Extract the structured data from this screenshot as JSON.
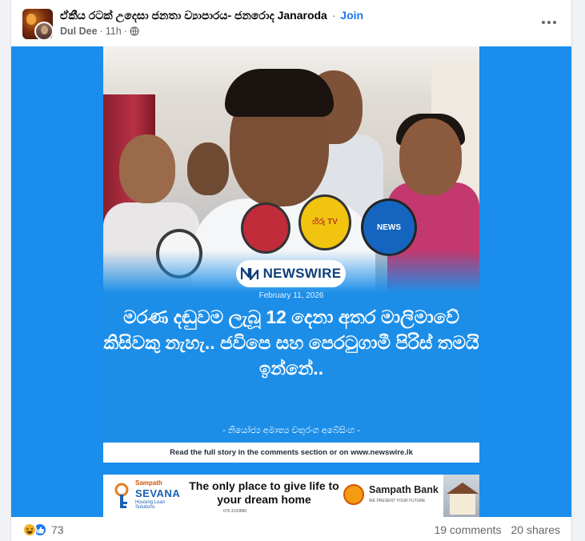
{
  "post": {
    "group_name": "ඒකීය රටක් උදෙසා ජනතා ව්‍යාපාරය- ජනරොද Janaroda",
    "separator": "·",
    "join_label": "Join",
    "author": "Dul Dee",
    "time": "11h",
    "meta_separator": "·",
    "visibility_icon": "globe-icon",
    "menu_icon": "more-horizontal-icon"
  },
  "image_card": {
    "newswire_label": "NEWSWIRE",
    "date": "February 11, 2026",
    "headline": "මරණ දඬුවම ලැබූ 12 දෙනා අතර මාලිමාවේ කිසිවකු නැහැ.. ජවිපෙ සහ පෙරටුගාමී පිරිස් තමයි ඉන්නේ..",
    "byline": "- නියෝජ්‍ය අමාත්‍ය චතුරංග අබේසිංහ -",
    "read_more": "Read the full story in the comments section or on www.newswire.lk",
    "mic_labels": [
      "",
      "",
      "හිරු TV",
      "NEWS"
    ]
  },
  "ad_banner": {
    "logo_top": "Sampath",
    "logo_name": "SEVANA",
    "logo_sub": "Housing Loan Solutions",
    "slogan": "The only place to give life to your dream home",
    "phone": "076 3193886",
    "bank_name": "Sampath Bank",
    "bank_tagline": "WE PRESENT YOUR FUTURE"
  },
  "footer": {
    "reaction_icons": [
      "haha-icon",
      "like-icon"
    ],
    "reaction_count": "73",
    "comments": "19 comments",
    "shares": "20 shares"
  },
  "colors": {
    "media_bg": "#1a8ded",
    "join": "#1877f2",
    "newswire_text": "#0d3f7a"
  }
}
